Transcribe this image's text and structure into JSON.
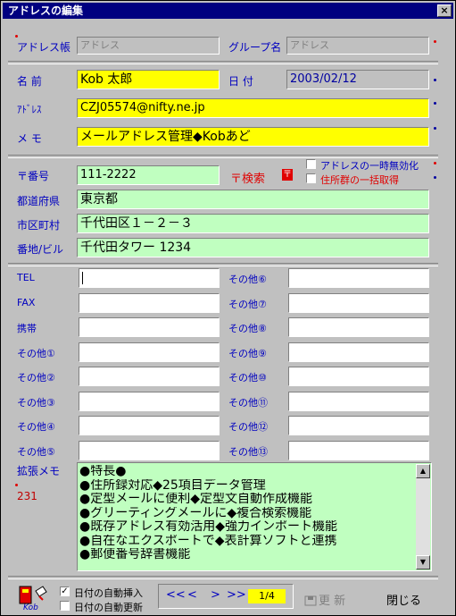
{
  "window": {
    "title": "アドレスの編集",
    "close": "×"
  },
  "header": {
    "addressbook_label": "アドレス帳",
    "addressbook_value": "アドレス",
    "group_label": "グループ名",
    "group_value": "アドレス"
  },
  "person": {
    "name_label": "名 前",
    "name_value": "Kob 太郎",
    "date_label": "日 付",
    "date_value": "2003/02/12",
    "address_label": "ｱﾄﾞﾚｽ",
    "address_value": "CZJ05574@nifty.ne.jp",
    "memo_label": "メ モ",
    "memo_value": "メールアドレス管理◆Kobあど"
  },
  "postal": {
    "zip_label": "〒番号",
    "zip_value": "111-2222",
    "search_button": "〒検索",
    "search_icon_glyph": "〒",
    "option1": "アドレスの一時無効化",
    "option2": "住所群の一括取得",
    "prefecture_label": "都道府県",
    "prefecture_value": "東京都",
    "city_label": "市区町村",
    "city_value": "千代田区１－２－３",
    "street_label": "番地/ビル",
    "street_value": "千代田タワー 1234"
  },
  "contacts": {
    "left": [
      {
        "label": "TEL",
        "value": ""
      },
      {
        "label": "FAX",
        "value": ""
      },
      {
        "label": "携帯",
        "value": ""
      },
      {
        "label": "その他①",
        "value": ""
      },
      {
        "label": "その他②",
        "value": ""
      },
      {
        "label": "その他③",
        "value": ""
      },
      {
        "label": "その他④",
        "value": ""
      },
      {
        "label": "その他⑤",
        "value": ""
      }
    ],
    "right": [
      {
        "label": "その他⑥",
        "value": ""
      },
      {
        "label": "その他⑦",
        "value": ""
      },
      {
        "label": "その他⑧",
        "value": ""
      },
      {
        "label": "その他⑨",
        "value": ""
      },
      {
        "label": "その他⑩",
        "value": ""
      },
      {
        "label": "その他⑪",
        "value": ""
      },
      {
        "label": "その他⑫",
        "value": ""
      },
      {
        "label": "その他⑬",
        "value": ""
      }
    ]
  },
  "ext_memo": {
    "label": "拡張メモ",
    "count": "231",
    "lines": [
      "●特長●",
      "●住所録対応◆25項目データ管理",
      "●定型メールに便利◆定型文自動作成機能",
      "●グリーティングメールに◆複合検索機能",
      "●既存アドレス有効活用◆強力インポート機能",
      "●自在なエクスポートで◆表計算ソフトと連携",
      "●郵便番号辞書機能"
    ]
  },
  "footer": {
    "logo_text": "Kob",
    "auto_insert_label": "日付の自動挿入",
    "auto_insert_checked": true,
    "auto_update_label": "日付の自動更新",
    "auto_update_checked": false,
    "nav_first": "<<",
    "nav_prev": "<",
    "nav_next": ">",
    "nav_last": ">>",
    "page": "1/4",
    "update_button": "更 新",
    "close_button": "閉じる"
  },
  "colors": {
    "title_bar": "#000080",
    "label_blue": "#0000c0",
    "field_yellow": "#ffff00",
    "field_green": "#c0ffc0",
    "red_accent": "#e00000"
  }
}
